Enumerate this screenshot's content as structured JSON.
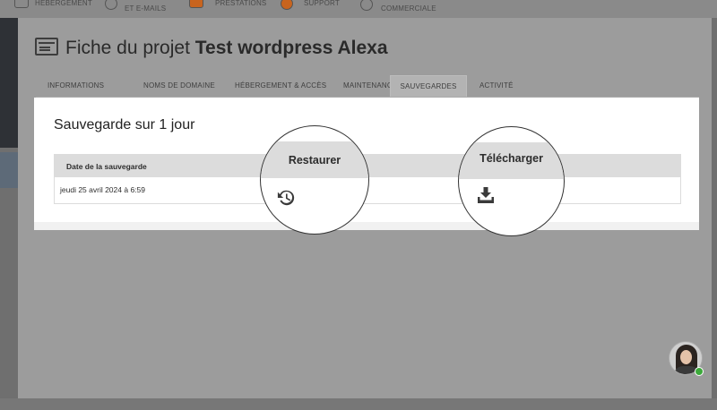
{
  "topnav": {
    "items": [
      {
        "label": "HÉBERGEMENT",
        "icon": "server-icon"
      },
      {
        "label": "ET E-MAILS",
        "icon": "globe-icon"
      },
      {
        "label": "PRESTATIONS",
        "icon": "monitor-icon"
      },
      {
        "label": "SUPPORT",
        "icon": "support-icon"
      },
      {
        "label": "COMMERCIALE",
        "icon": "database-icon"
      }
    ]
  },
  "page": {
    "title_prefix": "Fiche du projet",
    "title_project": "Test wordpress Alexa"
  },
  "tabs": [
    {
      "label": "INFORMATIONS",
      "active": false
    },
    {
      "label": "NOMS DE DOMAINE",
      "active": false
    },
    {
      "label": "HÉBERGEMENT & ACCÈS",
      "active": false
    },
    {
      "label": "MAINTENANCE",
      "active": false
    },
    {
      "label": "SAUVEGARDES",
      "active": true
    },
    {
      "label": "ACTIVITÉ",
      "active": false
    }
  ],
  "backups": {
    "section_title": "Sauvegarde sur 1 jour",
    "columns": {
      "date": "Date de la sauvegarde",
      "restore": "Restaurer",
      "download": "Télécharger"
    },
    "rows": [
      {
        "date": "jeudi 25 avril 2024 à 6:59",
        "restore_icon": "restore-history-icon",
        "download_icon": "download-tray-icon"
      }
    ]
  },
  "colors": {
    "accent_orange": "#c8641e",
    "online_status": "#3ca93a",
    "panel": "#ffffff",
    "overlay": "#9c9c9c"
  },
  "chat": {
    "avatar_icon": "agent-avatar",
    "status": "online"
  }
}
